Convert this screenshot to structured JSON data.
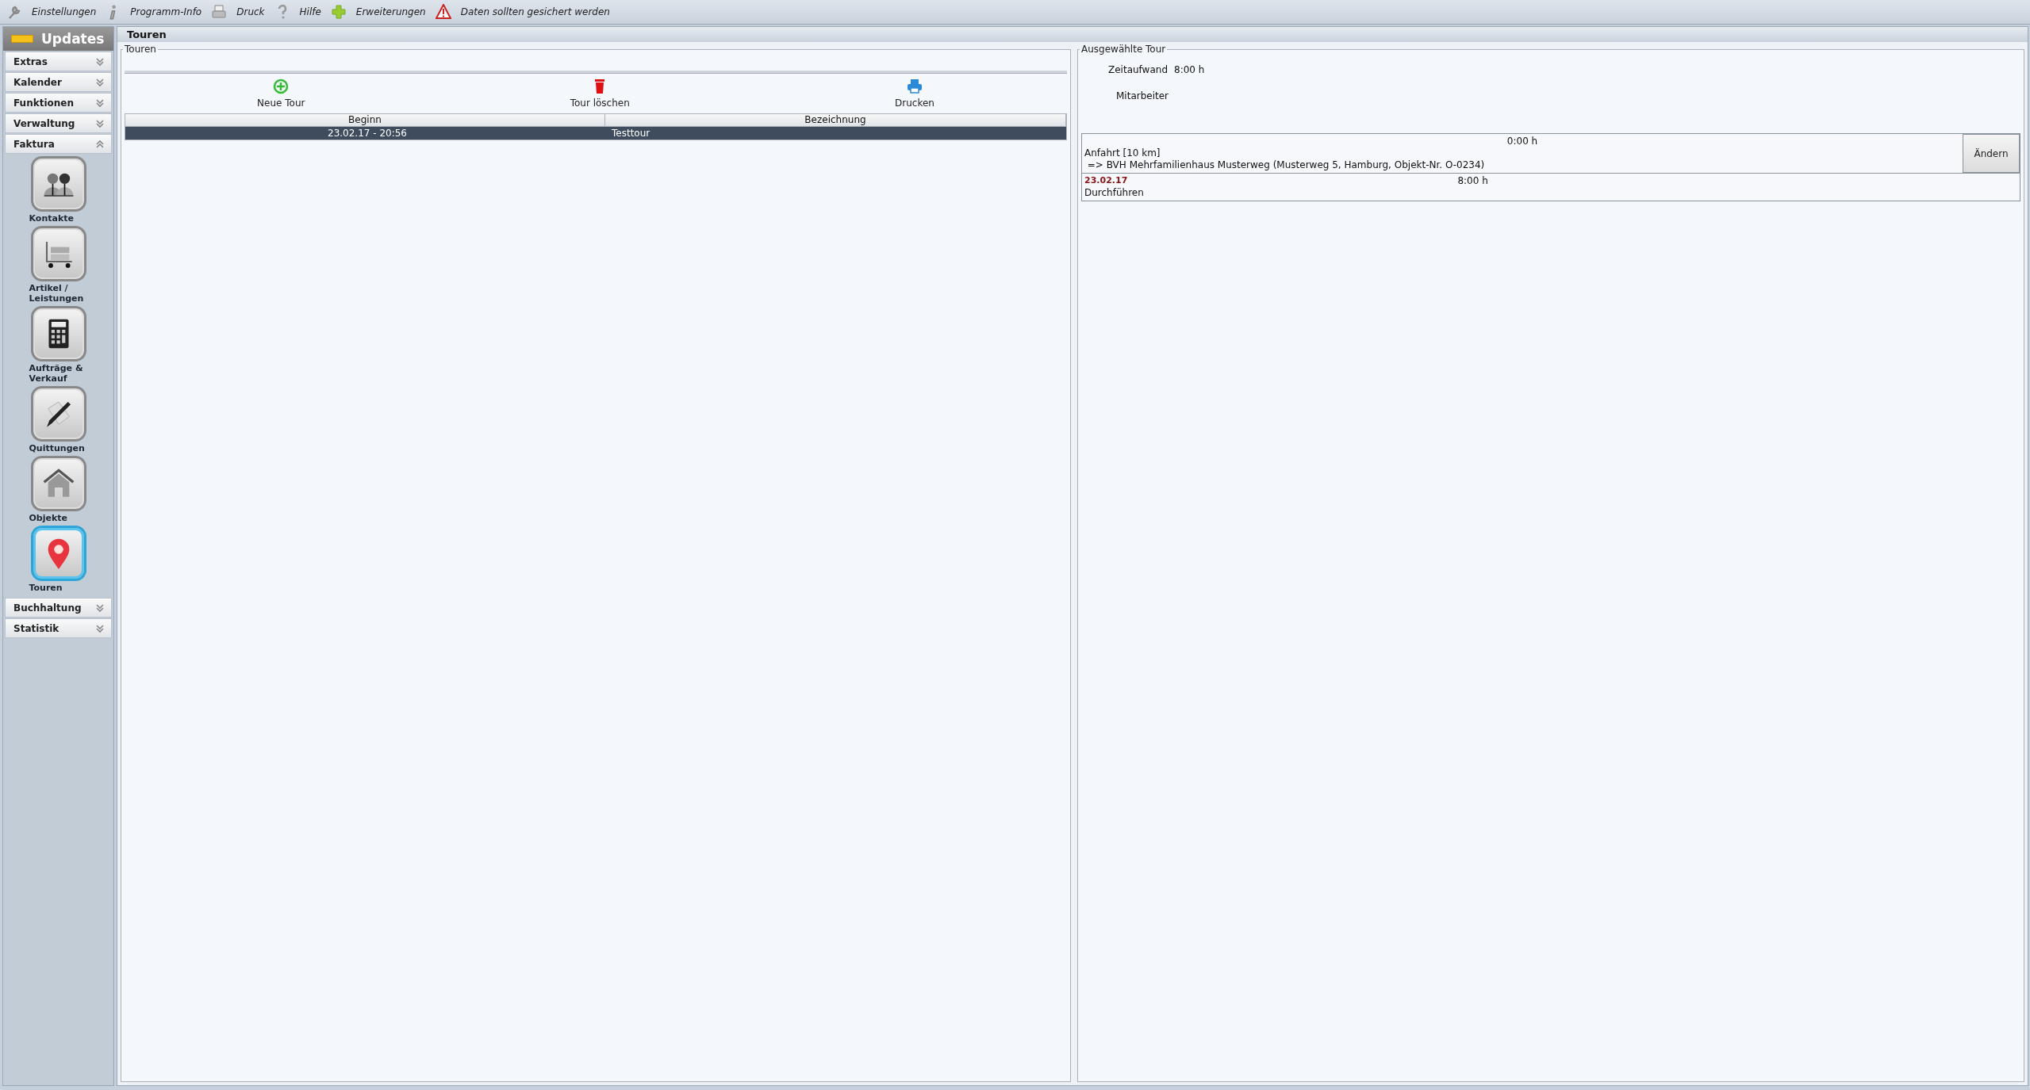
{
  "toolbar": [
    {
      "label": "Einstellungen"
    },
    {
      "label": "Programm-Info"
    },
    {
      "label": "Druck"
    },
    {
      "label": "Hilfe"
    },
    {
      "label": "Erweiterungen"
    },
    {
      "label": "Daten sollten gesichert werden"
    }
  ],
  "sidebar": {
    "title": "Updates",
    "sections": [
      {
        "label": "Extras",
        "expanded": false
      },
      {
        "label": "Kalender",
        "expanded": false
      },
      {
        "label": "Funktionen",
        "expanded": false
      },
      {
        "label": "Verwaltung",
        "expanded": false
      },
      {
        "label": "Faktura",
        "expanded": true,
        "items": [
          {
            "label": "Kontakte",
            "selected": false
          },
          {
            "label": "Artikel / Leistungen",
            "selected": false
          },
          {
            "label": "Aufträge & Verkauf",
            "selected": false
          },
          {
            "label": "Quittungen",
            "selected": false
          },
          {
            "label": "Objekte",
            "selected": false
          },
          {
            "label": "Touren",
            "selected": true
          }
        ]
      },
      {
        "label": "Buchhaltung",
        "expanded": false
      },
      {
        "label": "Statistik",
        "expanded": false
      }
    ]
  },
  "header": "Touren",
  "tours": {
    "title": "Touren",
    "actions": [
      "Neue Tour",
      "Tour löschen",
      "Drucken"
    ],
    "columns": [
      "Beginn",
      "Bezeichnung"
    ],
    "rows": [
      {
        "cells": [
          "23.02.17 - 20:56",
          "Testtour"
        ],
        "selected": true
      }
    ]
  },
  "selected_tour": {
    "title": "Ausgewählte Tour",
    "effort_label": "Zeitaufwand",
    "effort_value": "8:00 h",
    "staff_label": "Mitarbeiter",
    "entries": [
      {
        "kind": "travel",
        "time": "0:00 h",
        "lines": [
          "Anfahrt [10 km]",
          " => BVH Mehrfamilienhaus Musterweg (Musterweg 5, Hamburg, Objekt-Nr. O-0234)"
        ],
        "button": "Ändern"
      },
      {
        "kind": "task",
        "date": "23.02.17",
        "time": "8:00 h",
        "lines": [
          "Durchführen"
        ]
      }
    ]
  }
}
